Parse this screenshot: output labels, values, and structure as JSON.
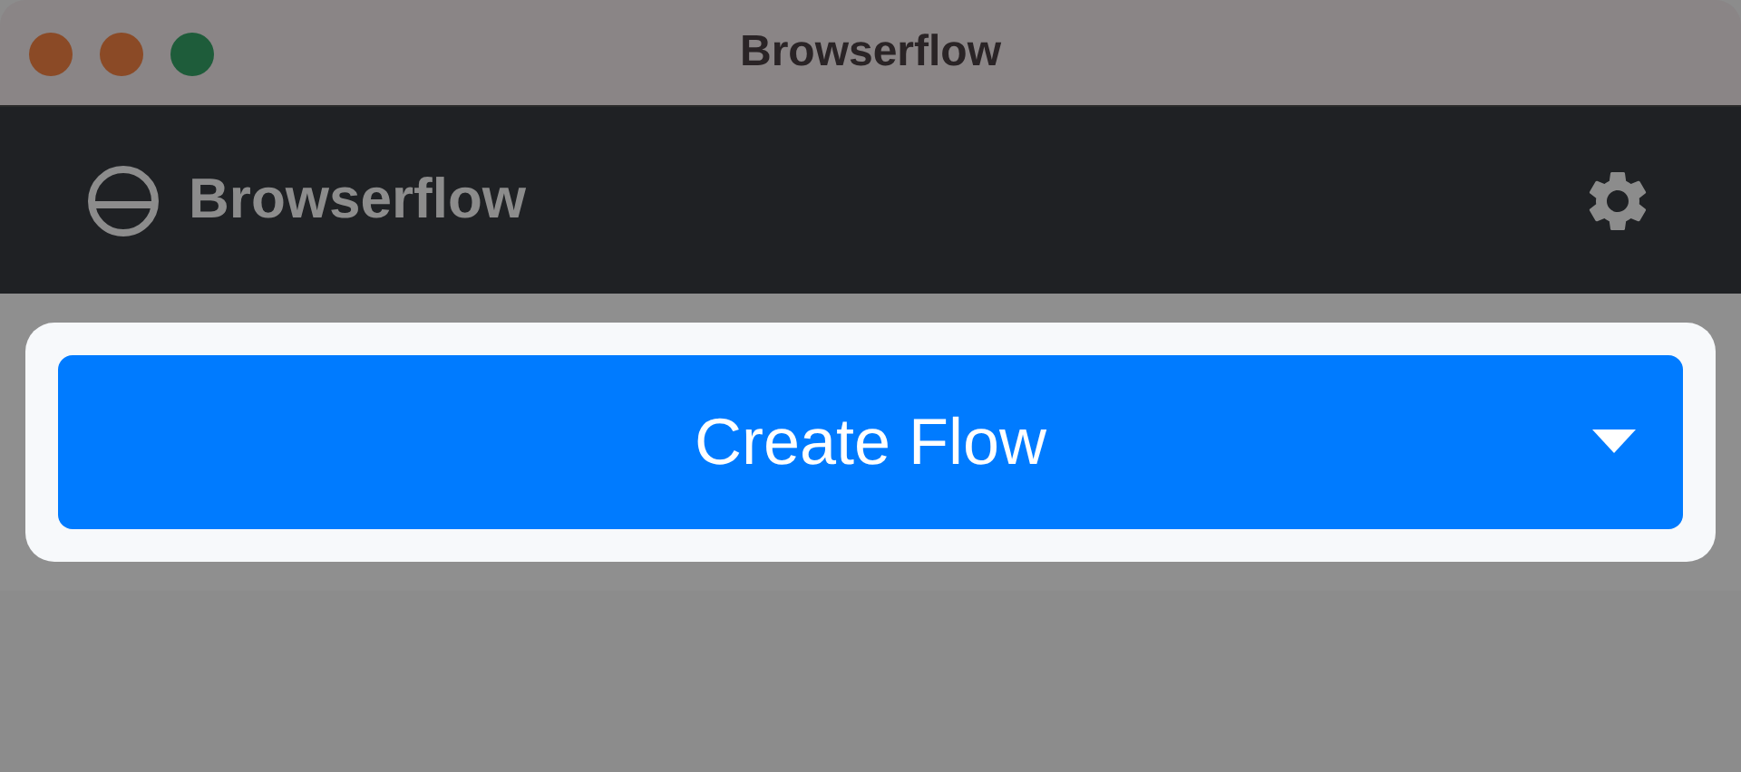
{
  "window": {
    "title": "Browserflow"
  },
  "header": {
    "brand": "Browserflow"
  },
  "create_button": {
    "label": "Create Flow"
  }
}
